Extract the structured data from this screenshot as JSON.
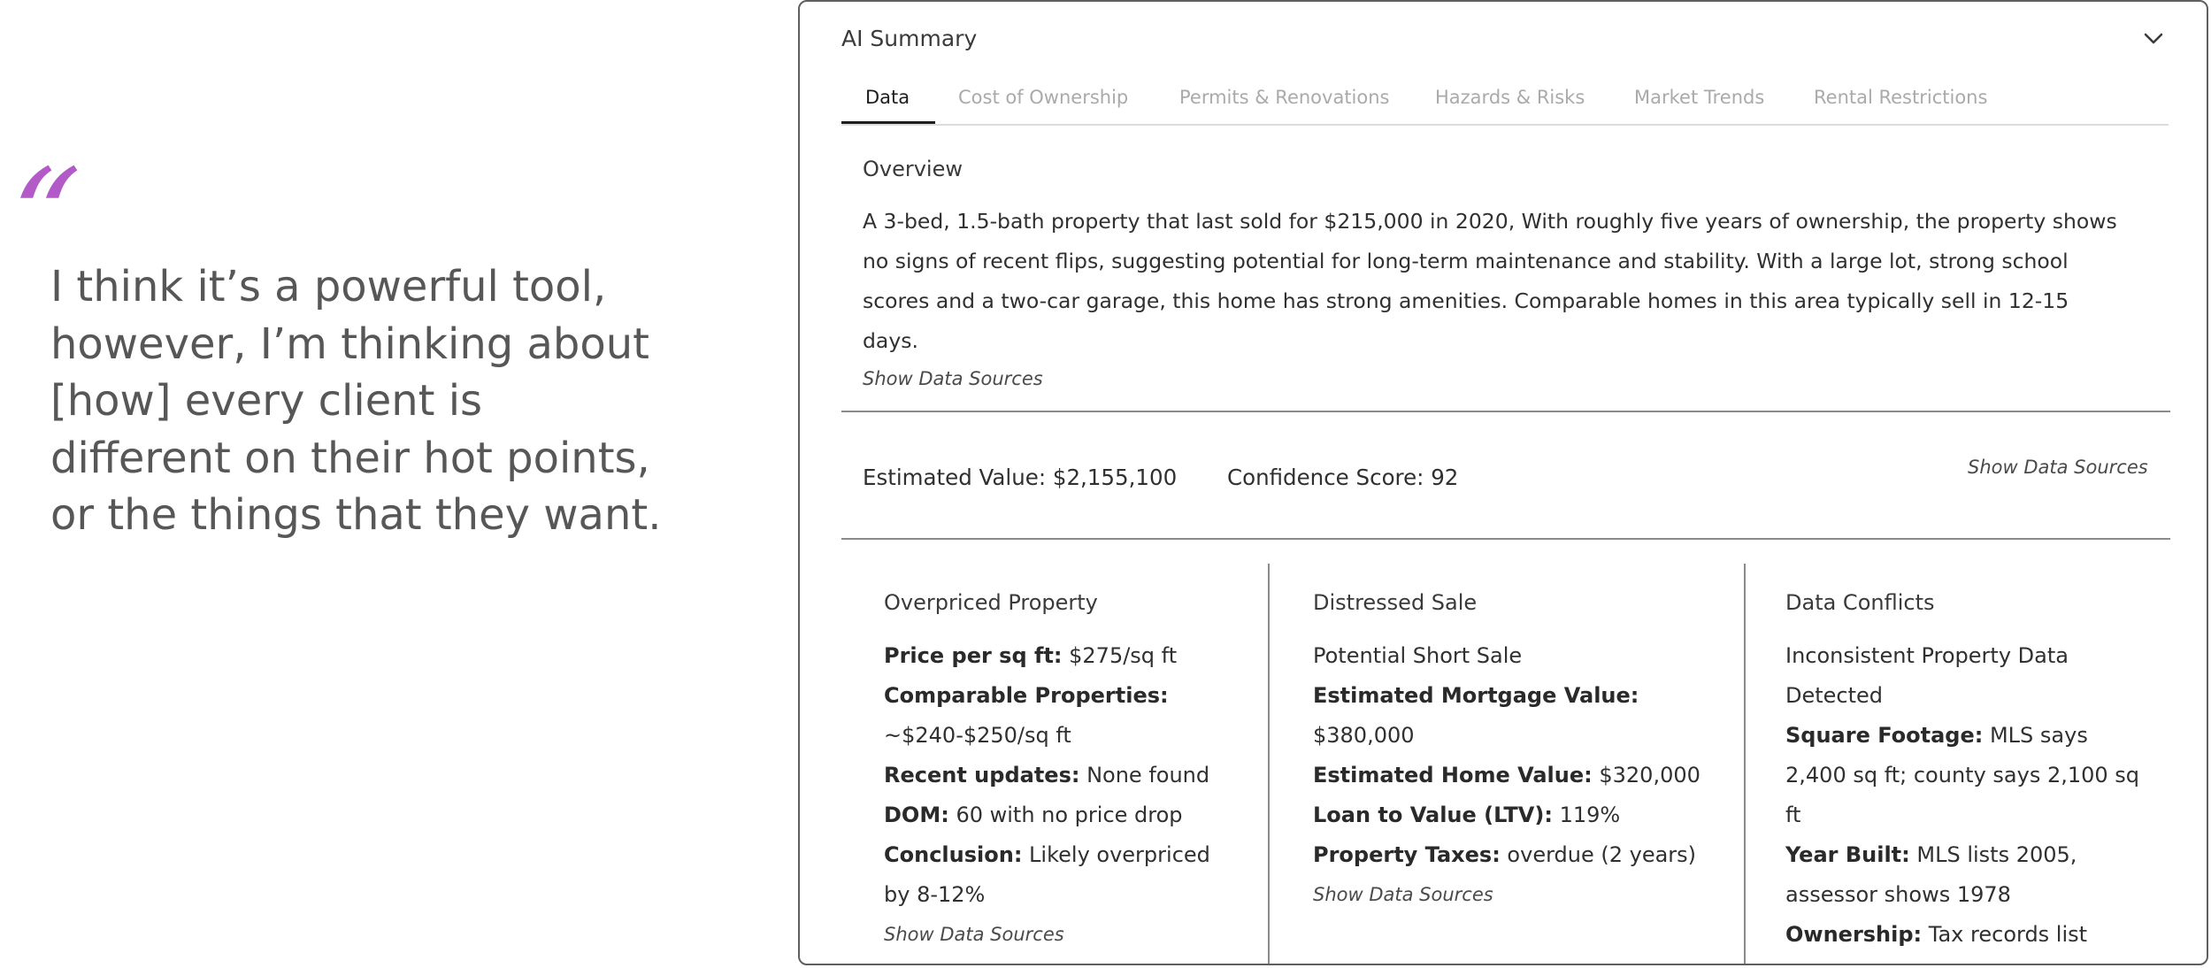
{
  "quote": {
    "mark": "“",
    "text": "I think it’s a powerful tool, however, I’m thinking about [how] every client is different on their hot points, or the things that they want."
  },
  "colors": {
    "accent": "#b25bc8",
    "border": "#5f5f5f"
  },
  "panel": {
    "title": "AI Summary",
    "collapse_icon": "chevron-down-icon",
    "tabs": [
      {
        "label": "Data",
        "active": true
      },
      {
        "label": "Cost of Ownership",
        "active": false
      },
      {
        "label": "Permits & Renovations",
        "active": false
      },
      {
        "label": "Hazards & Risks",
        "active": false
      },
      {
        "label": "Market Trends",
        "active": false
      },
      {
        "label": "Rental Restrictions",
        "active": false
      }
    ],
    "overview": {
      "title": "Overview",
      "text": "A 3-bed, 1.5-bath property that last sold for $215,000 in 2020, With roughly five years of ownership, the property shows no signs of recent flips, suggesting potential for long-term maintenance and stability. With a large lot, strong school scores and a two-car garage, this home has strong amenities. Comparable homes in this area typically sell in 12-15 days.",
      "sources_link": "Show Data Sources"
    },
    "estimate": {
      "value": "Estimated Value: $2,155,100",
      "confidence": "Confidence Score: 92",
      "sources_link": "Show Data Sources"
    },
    "columns": {
      "overpriced": {
        "title": "Overpriced Property",
        "price_label": "Price per sq ft:",
        "price_value": " $275/sq ft",
        "comp_label": "Comparable Properties:",
        "comp_value": "~$240-$250/sq ft",
        "updates_label": "Recent updates:",
        "updates_value": " None found",
        "dom_label": "DOM:",
        "dom_value": " 60 with no price drop",
        "conclusion_label": "Conclusion:",
        "conclusion_value": " Likely overpriced by 8-12%",
        "sources_link": "Show Data Sources"
      },
      "distressed": {
        "title": "Distressed Sale",
        "subtitle": "Potential Short Sale",
        "mortgage_label": "Estimated Mortgage Value:",
        "mortgage_value": "$380,000",
        "home_label": "Estimated Home Value:",
        "home_value": " $320,000",
        "ltv_label": "Loan to Value (LTV):",
        "ltv_value": " 119%",
        "taxes_label": "Property Taxes:",
        "taxes_value": " overdue (2 years)",
        "sources_link": "Show Data Sources"
      },
      "conflicts": {
        "title": "Data Conflicts",
        "subtitle": "Inconsistent Property Data Detected",
        "sqft_label": "Square Footage:",
        "sqft_value": " MLS says 2,400 sq ft; county says 2,100 sq ft",
        "year_label": "Year Built:",
        "year_value": " MLS lists 2005, assessor shows 1978",
        "owner_label": "Ownership:",
        "owner_value": " Tax records list"
      }
    }
  }
}
